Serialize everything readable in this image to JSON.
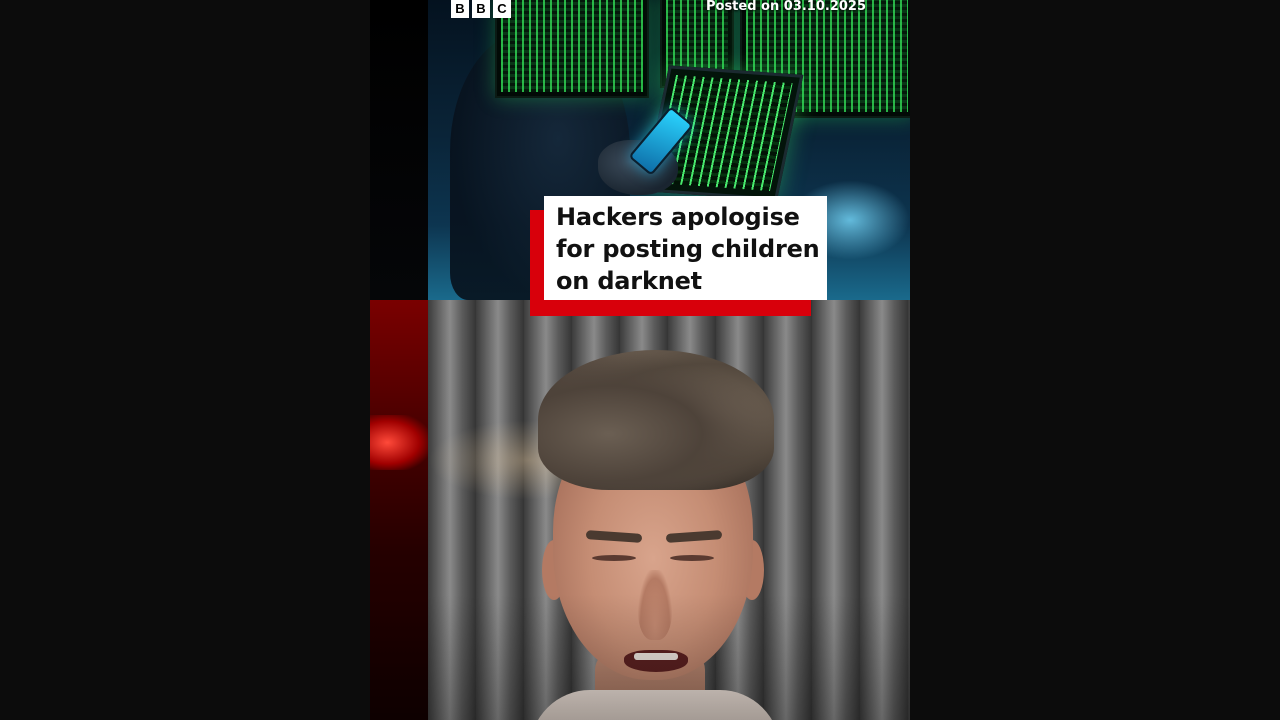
{
  "brand": {
    "logo_letters": [
      "B",
      "B",
      "C"
    ]
  },
  "video": {
    "posted_label": "Posted on 03.10.2025",
    "headline_lines": [
      "Hackers apologise",
      "for posting children",
      "on darknet"
    ]
  },
  "colors": {
    "page_background": "#0c0c0c",
    "headline_accent": "#d8000b",
    "headline_box": "#ffffff",
    "headline_text": "#111111"
  }
}
